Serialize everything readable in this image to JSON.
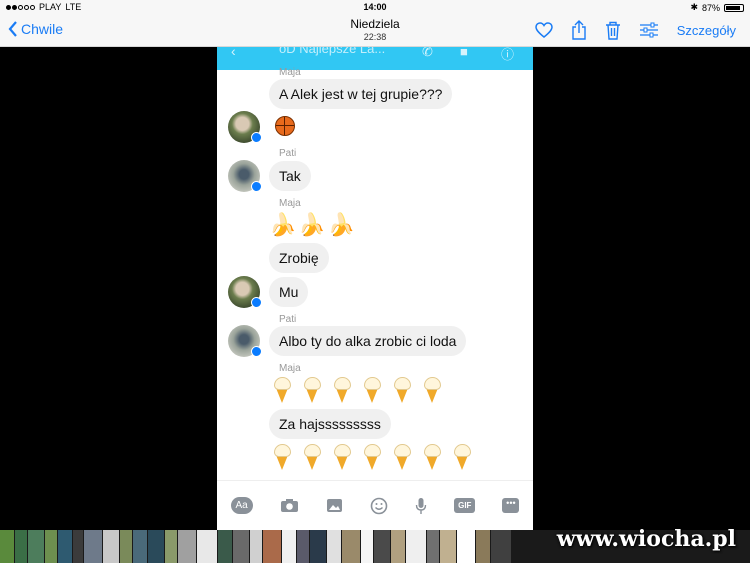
{
  "status_bar": {
    "carrier": "PLAY",
    "network": "LTE",
    "time": "14:00",
    "battery": "87%",
    "battery_level": 0.87,
    "signal_bars": 2
  },
  "nav": {
    "back_label": "Chwile",
    "title": "Niedziela",
    "subtitle": "22:38",
    "details_label": "Szczegóły",
    "accent": "#1a7cf5"
  },
  "messenger": {
    "header_title": "oD Najlepsze La...",
    "header_color": "#31c7f3",
    "messages": [
      {
        "sender": "Maja",
        "text": "A Alek jest w tej grupie???"
      },
      {
        "sender": "Maja",
        "emoji": "basketball"
      },
      {
        "sender": "Pati",
        "text": "Tak"
      },
      {
        "sender": "Maja",
        "emoji": "🍌🍌🍌"
      },
      {
        "sender": "Maja",
        "text": "Zrobię"
      },
      {
        "sender": "Maja",
        "text": "Mu"
      },
      {
        "sender": "Pati",
        "text": "Albo ty do alka zrobic ci loda"
      },
      {
        "sender": "Maja",
        "emoji": "ice-cream",
        "count": 6
      },
      {
        "sender": "Maja",
        "text": "Za hajsssssssss"
      },
      {
        "sender": "Maja",
        "emoji": "ice-cream",
        "count": 7
      }
    ],
    "composer_icons": [
      "text-format-icon",
      "camera-icon",
      "image-icon",
      "emoji-icon",
      "microphone-icon",
      "gif-icon",
      "more-icon"
    ],
    "composer_aa": "Aa",
    "composer_gif": "GIF"
  },
  "watermark": "www.wiocha.pl",
  "strip_colors": [
    "#5a8a3c",
    "#3a6e46",
    "#4d7d5c",
    "#6d8f4f",
    "#2e5a70",
    "#3b3b3b",
    "#6e7a8a",
    "#c8c8c8",
    "#7a8a5a",
    "#4a6a7a",
    "#2a4a5a",
    "#8a9a6a",
    "#a0a0a0",
    "#e8e8e8",
    "#3a5a4a",
    "#6a6a6a",
    "#d0d0d0",
    "#aa6a4a",
    "#f0f0f0",
    "#5a5a6a",
    "#2a3a4a",
    "#e0e0e0",
    "#9a8a6a",
    "#f5f5f5",
    "#4a4a4a",
    "#b0a080",
    "#efefef",
    "#707070",
    "#c0b090",
    "#ffffff",
    "#8a7a5a",
    "#404040"
  ]
}
